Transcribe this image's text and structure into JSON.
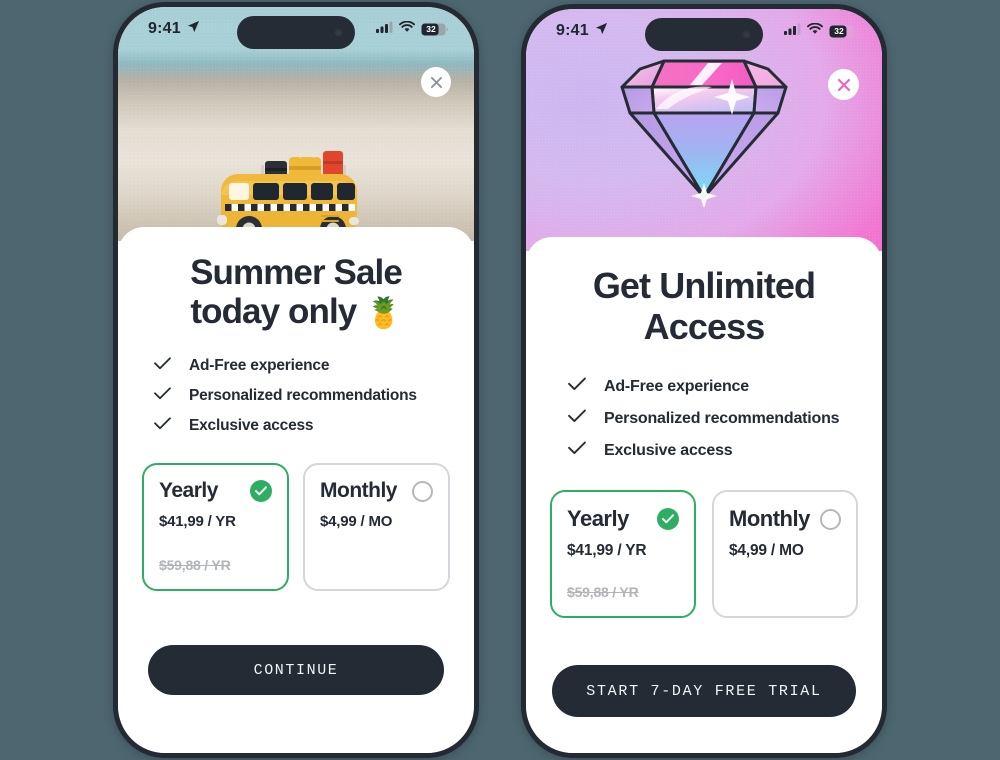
{
  "background_color": "#4d6670",
  "accent_green": "#2eae62",
  "dark_ink": "#242b35",
  "screens": [
    {
      "id": "summer-sale",
      "status_bar": {
        "time": "9:41",
        "location_icon": "location-arrow-icon",
        "cellular_icon": "cellular-bars-icon",
        "wifi_icon": "wifi-icon",
        "battery_level": "32"
      },
      "close_label": "×",
      "hero": {
        "art": "yellow-vintage-bus-on-beach",
        "background": "beach-blur-photo"
      },
      "title_line1": "Summer Sale",
      "title_line2": "today only",
      "title_emoji": "🍍",
      "features": [
        "Ad-Free experience",
        "Personalized recommendations",
        "Exclusive access"
      ],
      "plans": [
        {
          "name": "Yearly",
          "price": "$41,99 / YR",
          "old_price": "$59,88 / YR",
          "selected": true
        },
        {
          "name": "Monthly",
          "price": "$4,99 / MO",
          "old_price": "",
          "selected": false
        }
      ],
      "cta_label": "CONTINUE"
    },
    {
      "id": "unlimited-access",
      "status_bar": {
        "time": "9:41",
        "location_icon": "location-arrow-icon",
        "cellular_icon": "cellular-bars-icon",
        "wifi_icon": "wifi-icon",
        "battery_level": "32"
      },
      "close_label": "×",
      "hero": {
        "art": "diamond-gem-illustration",
        "background": "purple-pink-gradient"
      },
      "title_line1": "Get Unlimited",
      "title_line2": "Access",
      "title_emoji": "",
      "features": [
        "Ad-Free experience",
        "Personalized recommendations",
        "Exclusive access"
      ],
      "plans": [
        {
          "name": "Yearly",
          "price": "$41,99 / YR",
          "old_price": "$59,88 / YR",
          "selected": true
        },
        {
          "name": "Monthly",
          "price": "$4,99 / MO",
          "old_price": "",
          "selected": false
        }
      ],
      "cta_label": "START 7-DAY FREE TRIAL"
    }
  ]
}
